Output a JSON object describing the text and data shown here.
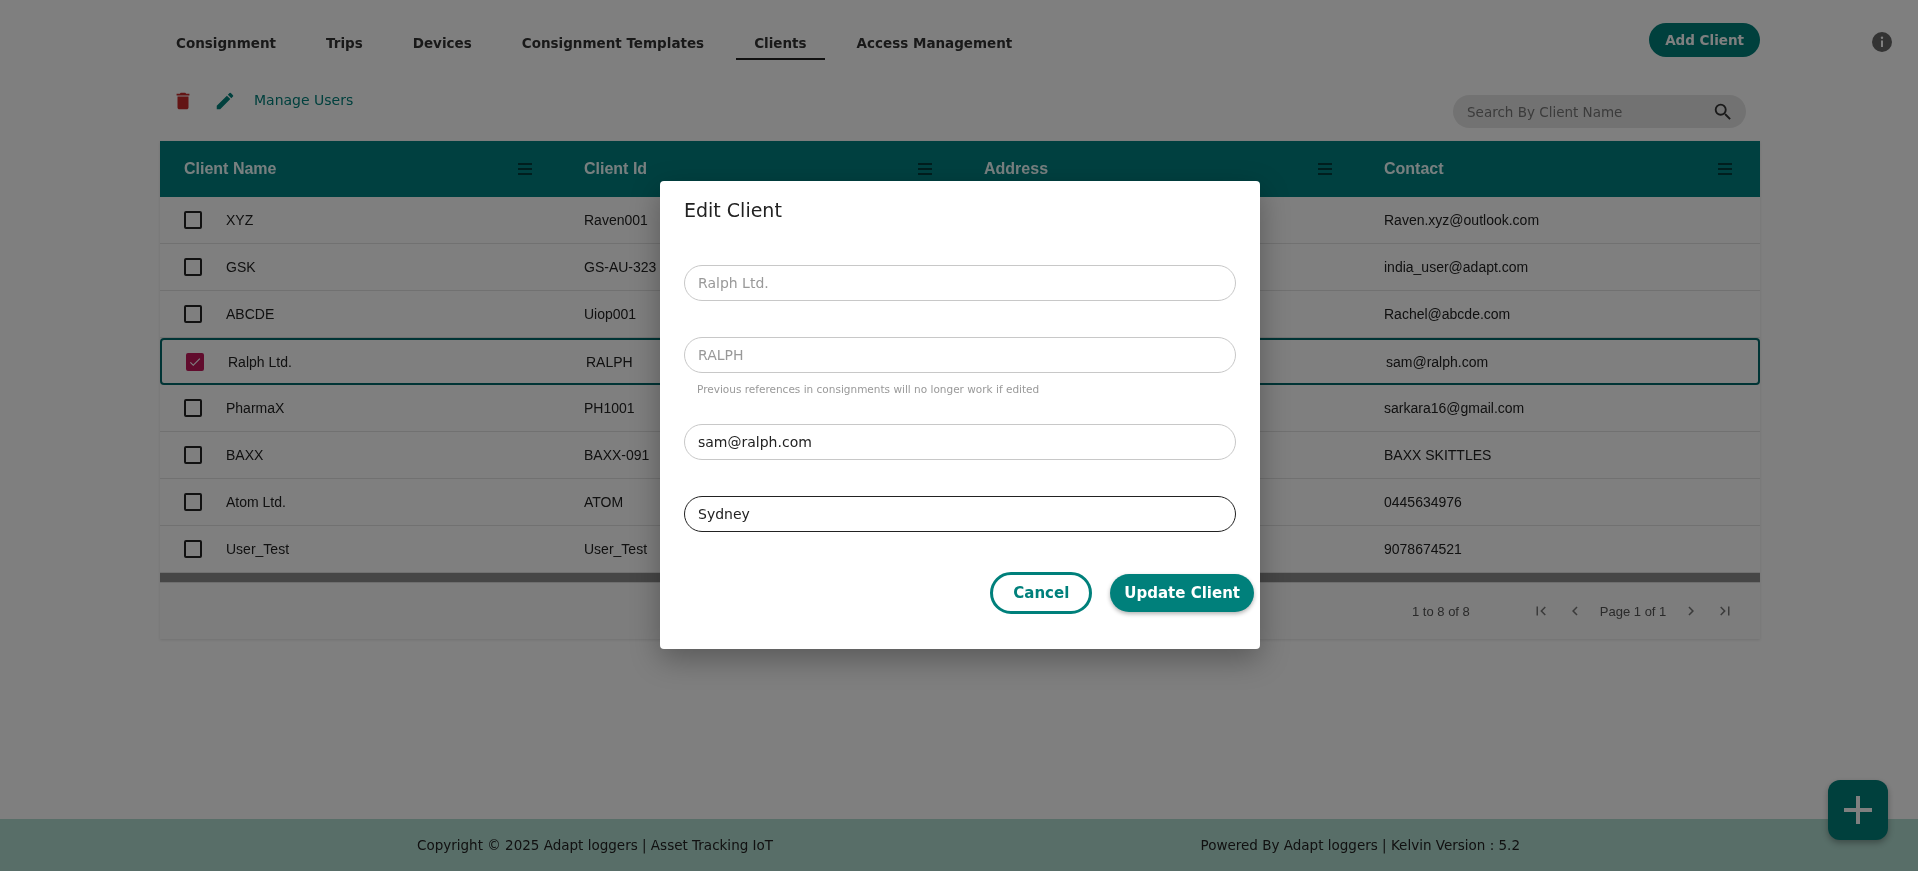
{
  "nav": {
    "tabs": [
      {
        "label": "Consignment",
        "selected": false
      },
      {
        "label": "Trips",
        "selected": false
      },
      {
        "label": "Devices",
        "selected": false
      },
      {
        "label": "Consignment Templates",
        "selected": false
      },
      {
        "label": "Clients",
        "selected": true
      },
      {
        "label": "Access Management",
        "selected": false
      }
    ],
    "add_button": "Add Client"
  },
  "toolbar": {
    "manage_users_link": "Manage Users"
  },
  "search": {
    "placeholder": "Search By Client Name"
  },
  "table": {
    "columns": [
      "Client Name",
      "Client Id",
      "Address",
      "Contact"
    ],
    "rows": [
      {
        "selected": false,
        "name": "XYZ",
        "client_id": "Raven001",
        "contact": "Raven.xyz@outlook.com"
      },
      {
        "selected": false,
        "name": "GSK",
        "client_id": "GS-AU-323",
        "contact": "india_user@adapt.com"
      },
      {
        "selected": false,
        "name": "ABCDE",
        "client_id": "Uiop001",
        "contact": "Rachel@abcde.com"
      },
      {
        "selected": true,
        "name": "Ralph Ltd.",
        "client_id": "RALPH",
        "contact": "sam@ralph.com"
      },
      {
        "selected": false,
        "name": "PharmaX",
        "client_id": "PH1001",
        "contact": "sarkara16@gmail.com"
      },
      {
        "selected": false,
        "name": "BAXX",
        "client_id": "BAXX-091",
        "contact": "BAXX SKITTLES"
      },
      {
        "selected": false,
        "name": "Atom Ltd.",
        "client_id": "ATOM",
        "contact": "0445634976"
      },
      {
        "selected": false,
        "name": "User_Test",
        "client_id": "User_Test",
        "contact": "9078674521"
      }
    ]
  },
  "pagination": {
    "summary": "1 to 8 of 8",
    "page": "Page 1 of 1"
  },
  "dialog": {
    "title": "Edit Client",
    "fields": [
      {
        "value": "Ralph Ltd.",
        "disabled": true,
        "focused": false
      },
      {
        "value": "RALPH",
        "disabled": true,
        "focused": false,
        "hint": "Previous references in consignments will no longer work if edited"
      },
      {
        "value": "sam@ralph.com",
        "disabled": false,
        "focused": false
      },
      {
        "value": "Sydney",
        "disabled": false,
        "focused": true
      }
    ],
    "buttons": [
      {
        "label": "Cancel",
        "kind": "outline"
      },
      {
        "label": "Update Client",
        "kind": "filled"
      }
    ]
  },
  "footer": {
    "copyright": "Copyright © 2025 Adapt loggers | Asset Tracking IoT",
    "powered": "Powered By Adapt loggers | Kelvin Version : 5.2"
  }
}
